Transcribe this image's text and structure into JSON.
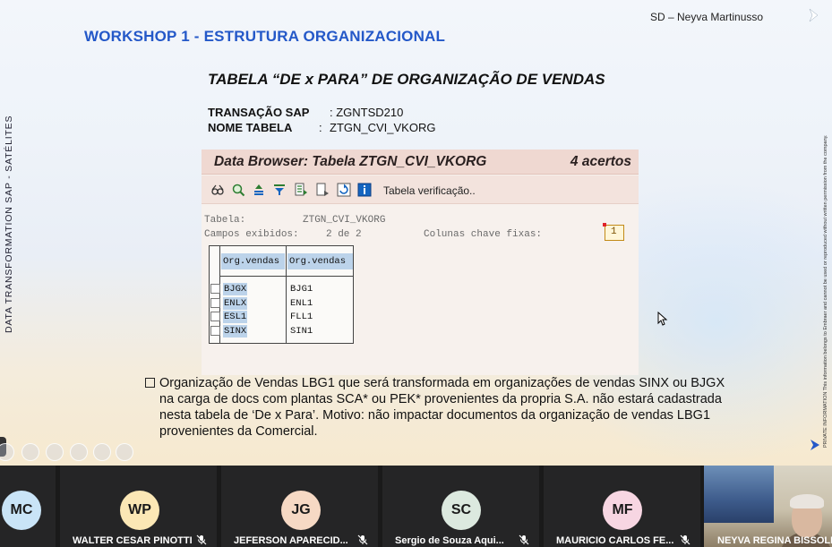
{
  "slide": {
    "presenter": "SD – Neyva Martinusso",
    "workshop_title": "WORKSHOP 1  -  ESTRUTURA ORGANIZACIONAL",
    "table_title": "TABELA “DE x PARA” DE  ORGANIZAÇÃO DE VENDAS",
    "transacao_label": "TRANSAÇÃO SAP",
    "transacao_value": ":  ZGNTSD210",
    "nome_label": "NOME TABELA",
    "nome_colon": ":",
    "nome_value": "ZTGN_CVI_VKORG",
    "vertical_left": "DATA  TRANSFORMATION   SAP   -   SATÉLITES",
    "vertical_right": "PRIVATE INFORMATION   This information belongs to Embraer and cannot be used or reproduced without written permission from the company.",
    "bullet_text": "Organização de Vendas LBG1 que será transformada em organizações de vendas SINX ou BJGX na carga de docs com plantas SCA* ou PEK* provenientes da propria S.A. não estará cadastrada nesta tabela de ‘De x Para’. Motivo: não impactar documentos da organização de vendas LBG1 provenientes da Comercial."
  },
  "sap": {
    "header_title": "Data Browser: Tabela ZTGN_CVI_VKORG",
    "header_count": "4 acertos",
    "toolbar_label": "Tabela verificação..",
    "toolbar_icons": [
      "glasses-icon",
      "search-icon",
      "sort-asc-icon",
      "filter-icon",
      "export-icon",
      "layout-icon",
      "refresh-icon",
      "info-icon"
    ],
    "tabela_label": "Tabela:",
    "tabela_value": "ZTGN_CVI_VKORG",
    "campos_label": "Campos exibidos:",
    "campos_value": "2 de   2",
    "chave_label": "Colunas chave fixas:",
    "chave_value": "1",
    "columns": [
      "Org.vendas",
      "Org.vendas"
    ],
    "rows": [
      {
        "key": "BJGX",
        "value": "BJG1"
      },
      {
        "key": "ENLX",
        "value": "ENL1"
      },
      {
        "key": "ESL1",
        "value": "FLL1"
      },
      {
        "key": "SINX",
        "value": "SIN1"
      }
    ]
  },
  "participants": [
    {
      "initials": "MC",
      "name": "",
      "color": "#c9e4f7"
    },
    {
      "initials": "WP",
      "name": "WALTER CESAR PINOTTI",
      "color": "#fbe7b5"
    },
    {
      "initials": "JG",
      "name": "JEFERSON APARECID...",
      "color": "#f6d9c4"
    },
    {
      "initials": "SC",
      "name": "Sergio de Souza Aqui...",
      "color": "#dce9df"
    },
    {
      "initials": "MF",
      "name": "MAURICIO CARLOS FE...",
      "color": "#f7d6e2"
    },
    {
      "initials": "",
      "name": "NEYVA REGINA BISSOLI",
      "color": ""
    }
  ],
  "colors": {
    "accent_title": "#2458c8",
    "sap_header": "#efd8d1",
    "sap_select": "#bcd3ea"
  }
}
